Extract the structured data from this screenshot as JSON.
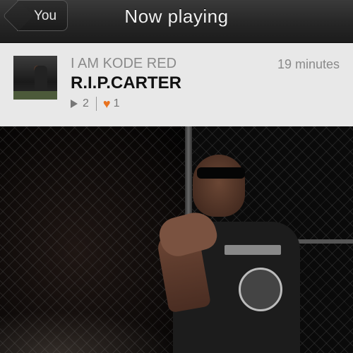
{
  "navbar": {
    "back_label": "You",
    "title": "Now playing"
  },
  "track": {
    "artist": "I AM KODE RED",
    "title": "R.I.P.CARTER",
    "time_ago": "19 minutes",
    "plays": "2",
    "likes": "1"
  },
  "icons": {
    "play": "play-icon",
    "heart": "heart-icon",
    "back": "chevron-left-icon"
  },
  "colors": {
    "accent": "#e8721f",
    "panel_bg": "#e8e8e8",
    "nav_bg": "#262626"
  }
}
